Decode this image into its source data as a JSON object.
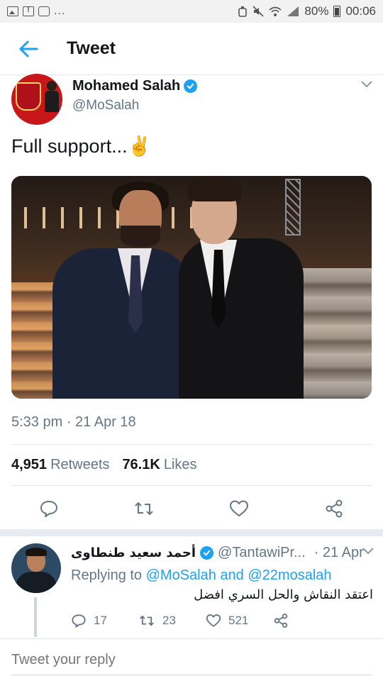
{
  "status_bar": {
    "battery": "80%",
    "time": "00:06",
    "notifications_more": "..."
  },
  "header": {
    "title": "Tweet"
  },
  "tweet": {
    "author_name": "Mohamed Salah",
    "author_handle": "@MoSalah",
    "text": "Full support...✌️",
    "timestamp": "5:33 pm · 21 Apr 18",
    "retweets_count": "4,951",
    "retweets_label": "Retweets",
    "likes_count": "76.1K",
    "likes_label": "Likes"
  },
  "reply": {
    "author_name": "أحمد سعيد طنطاوى",
    "author_handle": "@TantawiPr...",
    "time": "· 21 Apr",
    "replying_prefix": "Replying to",
    "replying_user1": "@MoSalah",
    "replying_and": "and",
    "replying_user2": "@22mosalah",
    "text": "اعتقد النقاش والحل السري افضل",
    "reply_count": "17",
    "retweet_count": "23",
    "like_count": "521"
  },
  "compose": {
    "placeholder": "Tweet your reply"
  },
  "colors": {
    "accent": "#1da1f2",
    "secondary_text": "#657786",
    "divider": "#e1e8ed"
  }
}
